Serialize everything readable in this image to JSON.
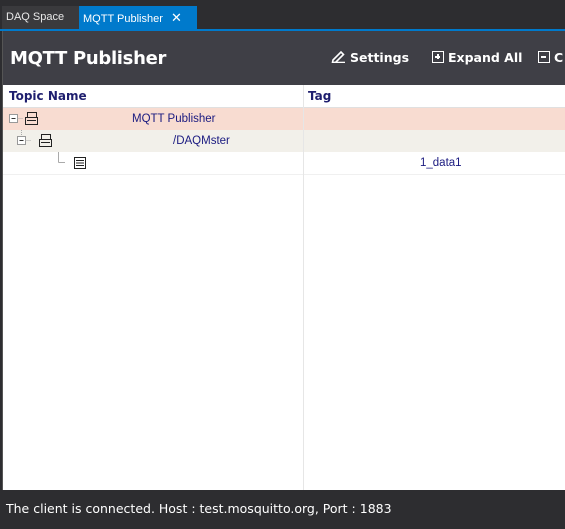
{
  "tabs": [
    {
      "label": "DAQ Space",
      "active": false
    },
    {
      "label": "MQTT Publisher",
      "active": true,
      "close_glyph": "✕"
    }
  ],
  "panel": {
    "title": "MQTT Publisher",
    "toolbar": {
      "settings_label": "Settings",
      "expand_all_label": "Expand All",
      "collapse_label": "C"
    }
  },
  "grid": {
    "columns": [
      "Topic Name",
      "Tag"
    ],
    "rows": [
      {
        "topic": "MQTT Publisher",
        "tag": "",
        "level": 0,
        "icon": "tree-node-icon",
        "expander": "minus"
      },
      {
        "topic": "/DAQMster",
        "tag": "",
        "level": 1,
        "icon": "tree-node-icon",
        "expander": "minus"
      },
      {
        "topic": "",
        "tag": "1_data1",
        "level": 2,
        "icon": "tree-leaf-icon",
        "expander": "none"
      }
    ]
  },
  "status": {
    "text": "The client is connected. Host : test.mosquitto.org, Port : 1883"
  },
  "colors": {
    "accent": "#007acc",
    "header_bg": "#3f3f46",
    "row_selected": "#f8dcd1",
    "row_alt": "#f2f0ea",
    "text_blue": "#1a1a80"
  }
}
